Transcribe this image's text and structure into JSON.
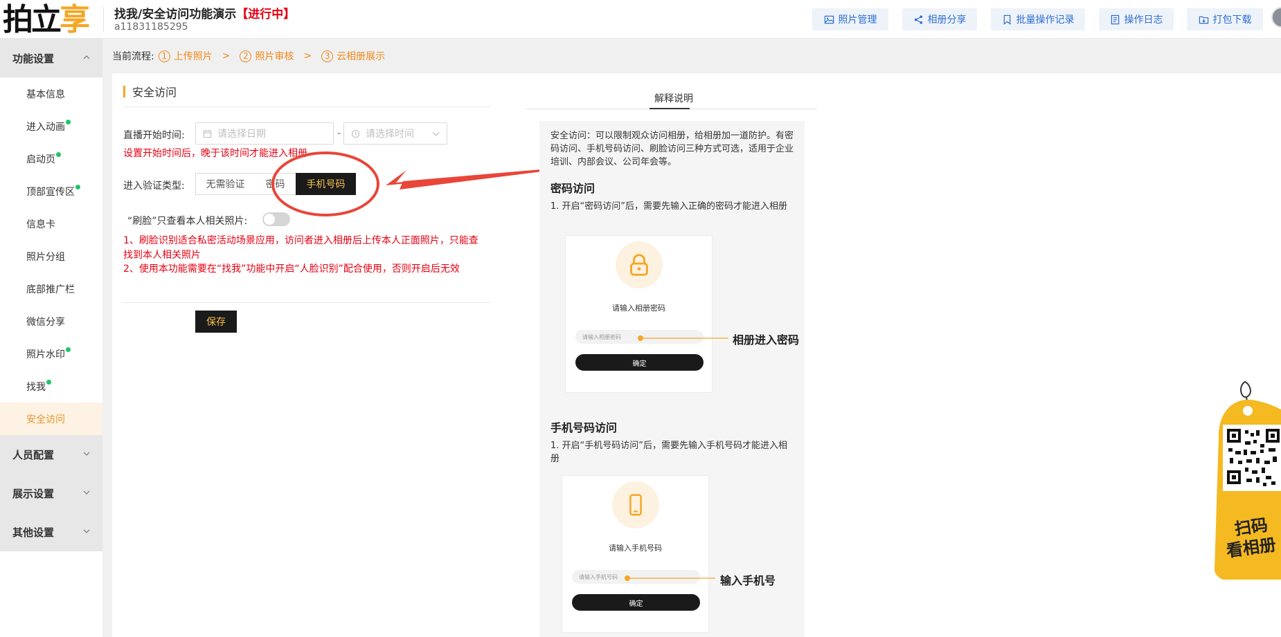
{
  "app": {
    "logo_part1": "拍立",
    "logo_part2": "享",
    "title": "找我/安全访问功能演示",
    "status": "【进行中】",
    "account_id": "a11831185295"
  },
  "toolbar": [
    {
      "label": "照片管理",
      "icon": "image-icon"
    },
    {
      "label": "相册分享",
      "icon": "share-icon"
    },
    {
      "label": "批量操作记录",
      "icon": "bookmark-icon"
    },
    {
      "label": "操作日志",
      "icon": "document-icon"
    },
    {
      "label": "打包下载",
      "icon": "folder-download-icon"
    }
  ],
  "sidebar": {
    "groups": [
      {
        "label": "功能设置",
        "expanded": true
      },
      {
        "label": "人员配置",
        "expanded": false
      },
      {
        "label": "展示设置",
        "expanded": false
      },
      {
        "label": "其他设置",
        "expanded": false
      }
    ],
    "items": [
      {
        "label": "基本信息",
        "dot": false
      },
      {
        "label": "进入动画",
        "dot": true
      },
      {
        "label": "启动页",
        "dot": true
      },
      {
        "label": "顶部宣传区",
        "dot": true
      },
      {
        "label": "信息卡",
        "dot": false
      },
      {
        "label": "照片分组",
        "dot": false
      },
      {
        "label": "底部推广栏",
        "dot": false
      },
      {
        "label": "微信分享",
        "dot": false
      },
      {
        "label": "照片水印",
        "dot": true
      },
      {
        "label": "找我",
        "dot": true
      },
      {
        "label": "安全访问",
        "dot": false,
        "active": true
      }
    ],
    "active_color": "#e8922a",
    "dot_color": "#1ec46b"
  },
  "flow": {
    "label": "当前流程:",
    "steps": [
      {
        "num": "1",
        "label": "上传照片"
      },
      {
        "num": "2",
        "label": "照片审核"
      },
      {
        "num": "3",
        "label": "云相册展示"
      }
    ],
    "separator": ">"
  },
  "form": {
    "section_title": "安全访问",
    "start_time_label": "直播开始时间:",
    "date_placeholder": "请选择日期",
    "range_sep": "-",
    "time_placeholder": "请选择时间",
    "start_time_hint": "设置开始时间后，晚于该时间才能进入相册",
    "verify_label": "进入验证类型:",
    "verify_options": [
      "无需验证",
      "密码",
      "手机号码"
    ],
    "verify_selected": "手机号码",
    "face_label": "“刷脸”只查看本人相关照片:",
    "face_enabled": false,
    "face_notes": [
      "1、刷脸识别适合私密活动场景应用，访问者进入相册后上传本人正面照片，只能查找到本人相关照片",
      "2、使用本功能需要在“找我”功能中开启“人脸识别”配合使用，否则开启后无效"
    ],
    "save_label": "保存"
  },
  "explain": {
    "tab_label": "解释说明",
    "intro": "安全访问：可以限制观众访问相册，给相册加一道防护。有密码访问、手机号码访问、刷脸访问三种方式可选，适用于企业培训、内部会议、公司年会等。",
    "password": {
      "heading": "密码访问",
      "step": "1. 开启“密码访问”后，需要先输入正确的密码才能进入相册",
      "mock_title": "请输入相册密码",
      "mock_placeholder": "请输入相册密码",
      "mock_button": "确定",
      "annotation": "相册进入密码"
    },
    "phone": {
      "heading": "手机号码访问",
      "step": "1. 开启“手机号码访问”后，需要先输入手机号码才能进入相册",
      "mock_title": "请输入手机号码",
      "mock_placeholder": "请输入手机号码",
      "mock_button": "确定",
      "annotation": "输入手机号"
    }
  },
  "qr_tag": {
    "line1": "扫码",
    "line2": "看相册"
  },
  "colors": {
    "accent": "#f5a623",
    "danger": "#e60012",
    "link_blue": "#2f6fd1",
    "dark": "#1a1a1a"
  }
}
